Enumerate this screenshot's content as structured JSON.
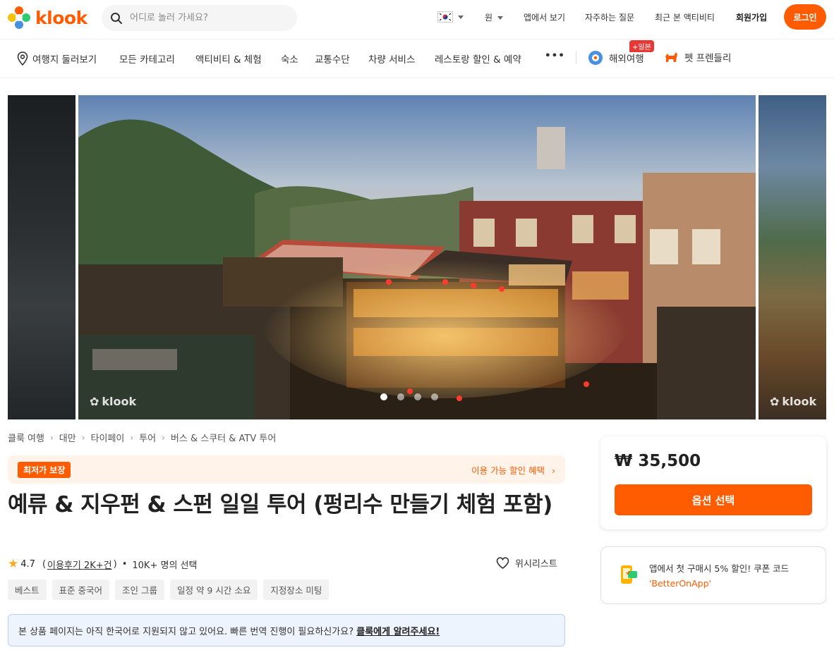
{
  "header": {
    "logo_text": "klook",
    "search_placeholder": "어디로 놀러 가세요?",
    "currency": "원",
    "view_in_app": "앱에서 보기",
    "faq": "자주하는 질문",
    "recently_viewed": "최근 본 액티비티",
    "signup": "회원가입",
    "login": "로그인"
  },
  "catnav": {
    "items": [
      "여행지 둘러보기",
      "모든 카테고리",
      "액티비티 & 체험",
      "숙소",
      "교통수단",
      "차량 서비스",
      "레스토랑 할인 & 예약"
    ],
    "more": "•••",
    "overseas": "해외여행",
    "overseas_badge": "+일본",
    "pet": "펫 프렌들리"
  },
  "gallery": {
    "watermark": "klook",
    "slide_count": 4,
    "active_slide": 1
  },
  "breadcrumb": [
    "클룩 여행",
    "대만",
    "타이페이",
    "투어",
    "버스 & 스쿠터 & ATV 투어"
  ],
  "guarantee": {
    "badge": "최저가 보장",
    "link": "이용 가능 할인 혜택"
  },
  "title": "예류 & 지우펀 & 스펀 일일 투어 (펑리수 만들기 체험 포함)",
  "meta": {
    "rating": "4.7",
    "reviews": "이용후기 2K+건",
    "booked": "10K+ 명의 선택",
    "wishlist": "위시리스트"
  },
  "tags": [
    "베스트",
    "표준 중국어",
    "조인 그룹",
    "일정 약 9 시간  소요",
    "지정장소 미팅"
  ],
  "notice": {
    "text": "본 상품 페이지는 아직 한국어로 지원되지 않고 있어요. 빠른 번역 진행이 필요하신가요? ",
    "link": "클룩에게 알려주세요!"
  },
  "price_card": {
    "price": "₩ 35,500",
    "button": "옵션 선택"
  },
  "app_card": {
    "line1": "앱에서 첫 구매시 5% 할인! 쿠폰 코드",
    "code": "'BetterOnApp'"
  },
  "colors": {
    "brand": "#ff5b00",
    "notice_bg": "#eef4fd",
    "guarantee_bg": "#fff3ea",
    "star": "#f9a825"
  }
}
